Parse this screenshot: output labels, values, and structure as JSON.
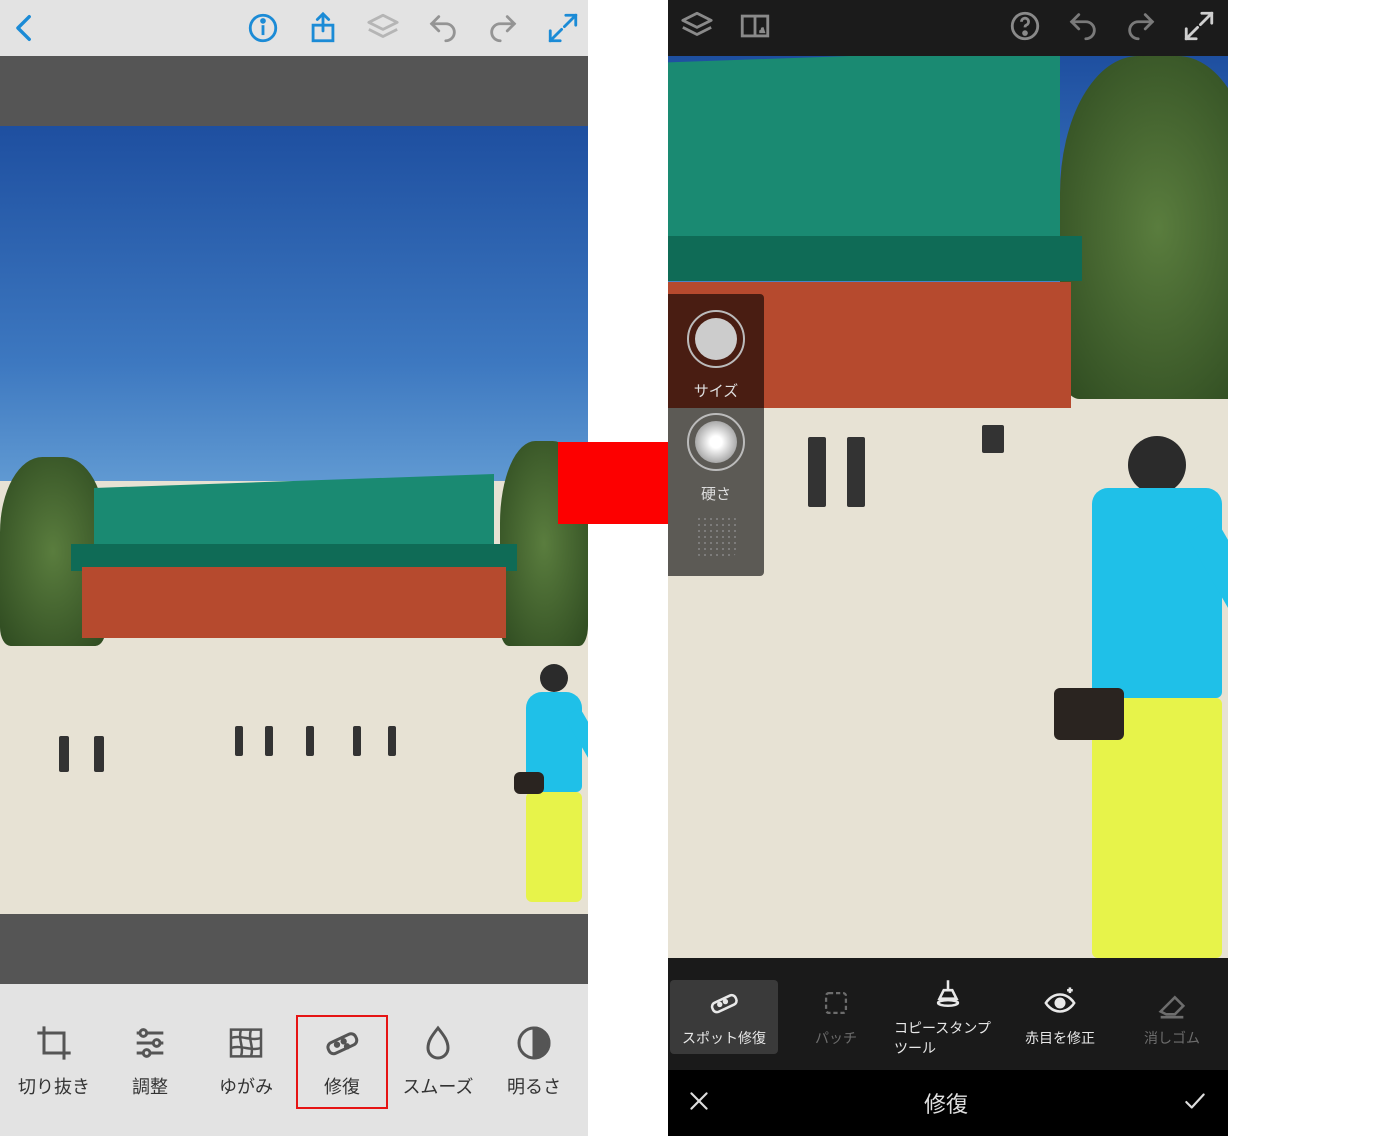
{
  "left": {
    "iconbar": {
      "back": "back-icon",
      "info": "info-icon",
      "share": "share-icon",
      "layers": "layers-icon",
      "undo": "undo-icon",
      "redo": "redo-icon",
      "fullscreen": "fullscreen-icon"
    },
    "tools": [
      {
        "id": "crop",
        "label": "切り抜き",
        "selected": false
      },
      {
        "id": "adjust",
        "label": "調整",
        "selected": false
      },
      {
        "id": "distort",
        "label": "ゆがみ",
        "selected": false
      },
      {
        "id": "heal",
        "label": "修復",
        "selected": true
      },
      {
        "id": "smooth",
        "label": "スムーズ",
        "selected": false
      },
      {
        "id": "brightness",
        "label": "明るさ",
        "selected": false
      }
    ]
  },
  "right": {
    "iconbar": {
      "layers": "layers-icon",
      "compare": "compare-icon",
      "help": "help-icon",
      "undo": "undo-icon",
      "redo": "redo-icon",
      "fullscreen": "fullscreen-icon"
    },
    "overlay": {
      "size_label": "サイズ",
      "hardness_label": "硬さ"
    },
    "tools": [
      {
        "id": "spot-heal",
        "label": "スポット修復",
        "state": "active"
      },
      {
        "id": "patch",
        "label": "パッチ",
        "state": "dim"
      },
      {
        "id": "clone",
        "label": "コピースタンプツール",
        "state": "normal"
      },
      {
        "id": "redeye",
        "label": "赤目を修正",
        "state": "normal"
      },
      {
        "id": "eraser",
        "label": "消しゴム",
        "state": "dim"
      }
    ],
    "footer": {
      "title": "修復"
    }
  }
}
